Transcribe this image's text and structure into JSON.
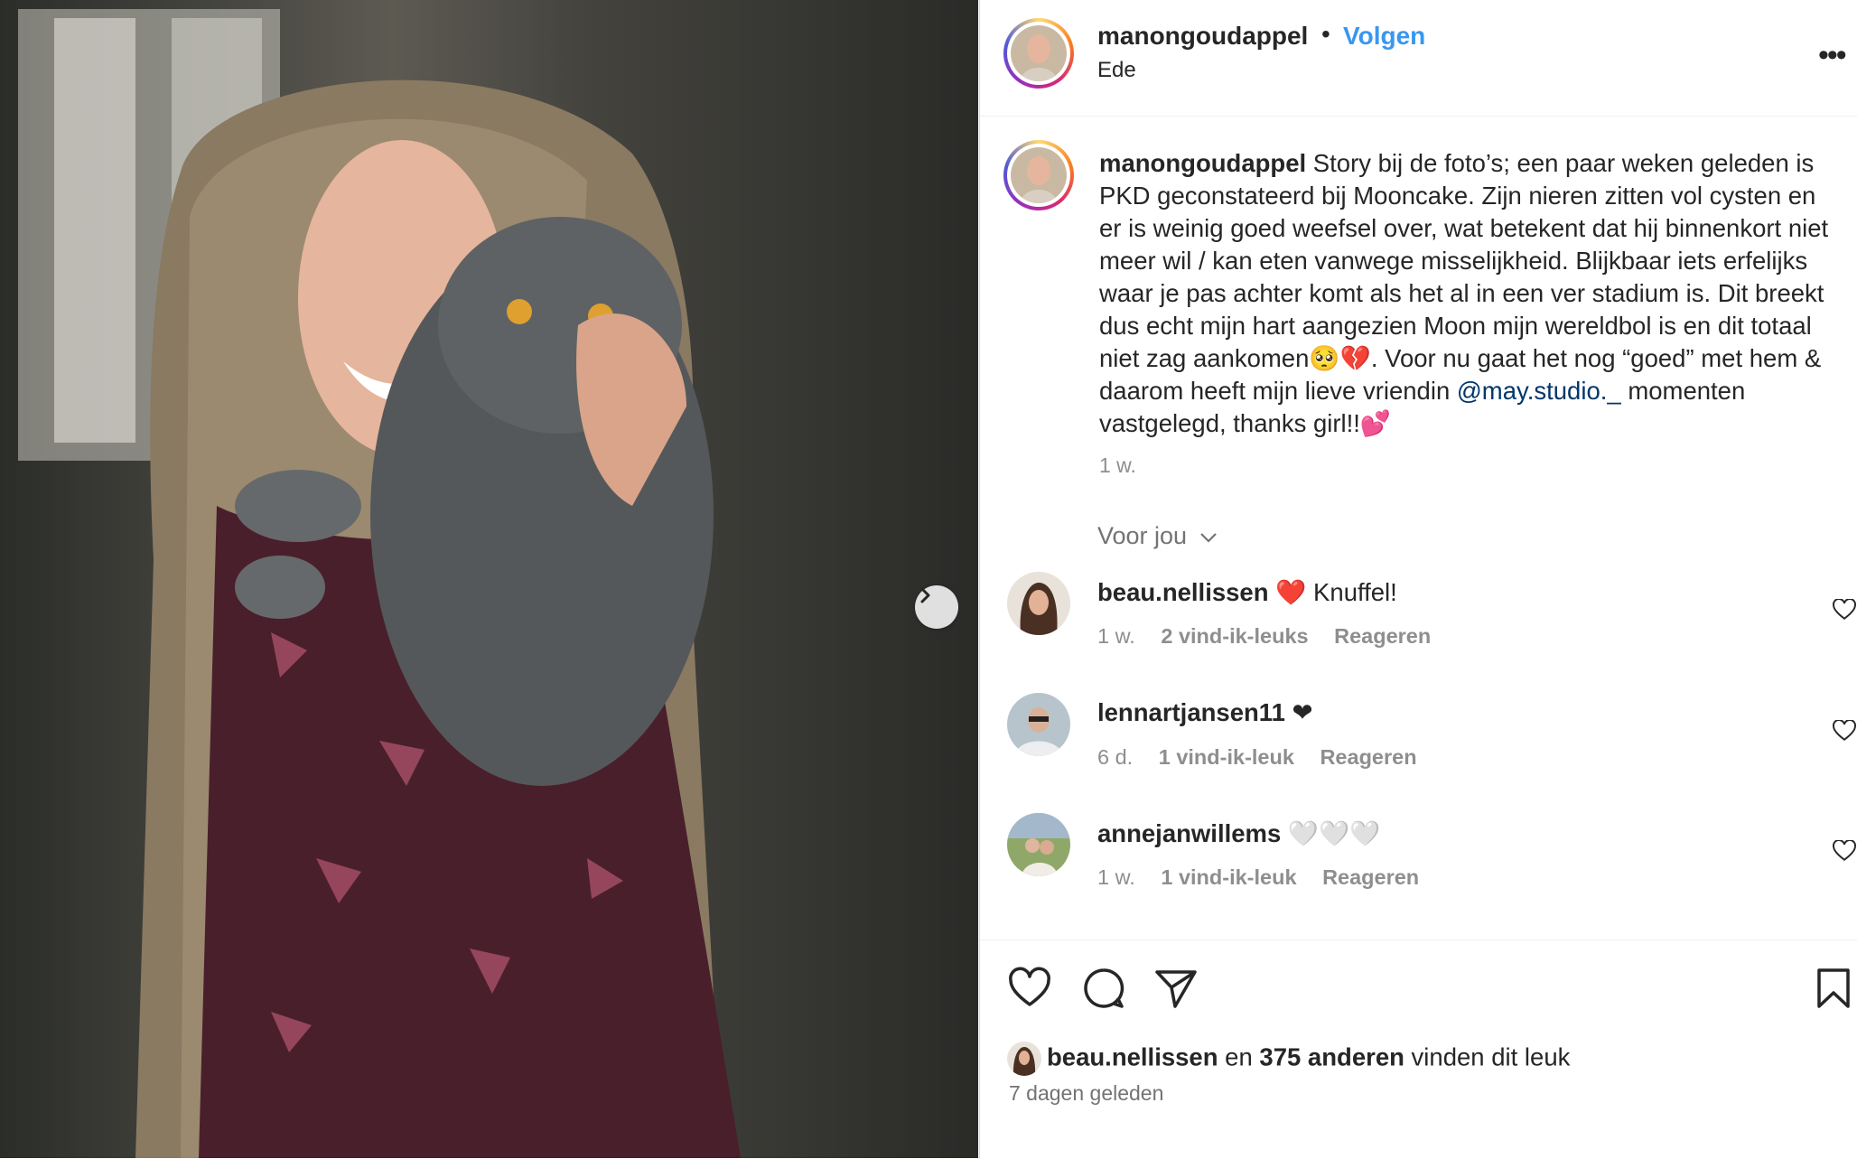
{
  "post": {
    "author": "manongoudappel",
    "follow_label": "Volgen",
    "location": "Ede",
    "caption_user": "manongoudappel",
    "caption_part1": " Story bij de foto’s; een paar weken geleden is PKD geconstateerd bij Mooncake. Zijn nieren zitten vol cysten en er is weinig goed weefsel over, wat betekent dat hij binnenkort niet meer wil / kan eten vanwege misselijkheid. Blijkbaar iets erfelijks waar je pas achter komt als het al in een ver stadium is. Dit breekt dus echt mijn hart aangezien Moon mijn wereldbol is en dit totaal niet zag aankomen🥺💔. Voor nu gaat het nog “goed” met hem & daarom heeft mijn lieve vriendin ",
    "caption_mention": "@may.studio._",
    "caption_part2": " momenten vastgelegd, thanks girl!!💕",
    "caption_time": "1 w."
  },
  "comments_header": "Voor jou",
  "comments": [
    {
      "user": "beau.nellissen",
      "text": " ❤️ Knuffel!",
      "time": "1 w.",
      "likes": "2 vind-ik-leuks",
      "reply": "Reageren"
    },
    {
      "user": "lennartjansen11",
      "text": " ❤",
      "time": "6 d.",
      "likes": "1 vind-ik-leuk",
      "reply": "Reageren"
    },
    {
      "user": "annejanwillems",
      "text": " 🤍🤍🤍",
      "time": "1 w.",
      "likes": "1 vind-ik-leuk",
      "reply": "Reageren"
    }
  ],
  "likes_summary": {
    "first_user": "beau.nellissen",
    "connector": " en ",
    "others": "375 anderen",
    "suffix": " vinden dit leuk"
  },
  "post_date": "7 dagen geleden",
  "icons": [
    "more-icon",
    "next-arrow-icon",
    "heart-icon",
    "comment-icon",
    "share-icon",
    "bookmark-icon"
  ],
  "colors": {
    "link_blue": "#3897f0",
    "mention": "#00376b",
    "muted": "#8e8e8e"
  }
}
